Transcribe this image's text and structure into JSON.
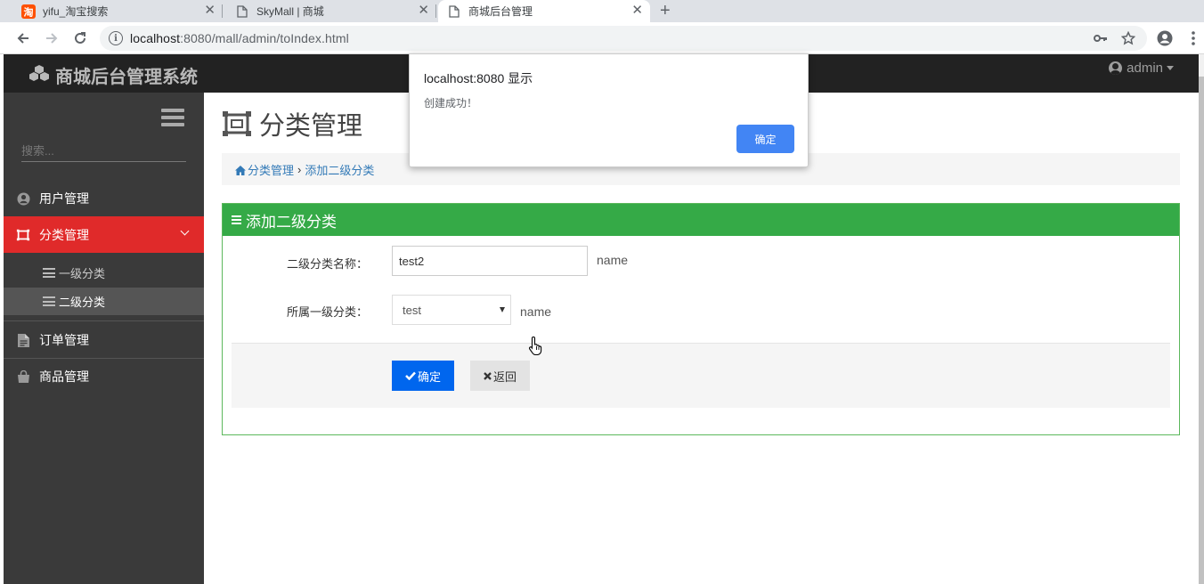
{
  "browser": {
    "tabs": [
      {
        "title": "yifu_淘宝搜索",
        "favicon": "taobao-icon"
      },
      {
        "title": "SkyMall | 商城",
        "favicon": "document-icon"
      },
      {
        "title": "商城后台管理",
        "favicon": "document-icon",
        "active": true
      }
    ],
    "new_tab": "+",
    "url_host": "localhost",
    "url_path": ":8080/mall/admin/toIndex.html"
  },
  "header": {
    "brand": "商城后台管理系统",
    "user": "admin"
  },
  "sidebar": {
    "search_placeholder": "搜索...",
    "items": [
      {
        "label": "用户管理",
        "icon": "user-circle-icon"
      },
      {
        "label": "分类管理",
        "icon": "crop-icon",
        "active": true
      },
      {
        "label": "订单管理",
        "icon": "file-text-icon"
      },
      {
        "label": "商品管理",
        "icon": "shopping-bag-icon"
      }
    ],
    "subitems": [
      {
        "label": "一级分类"
      },
      {
        "label": "二级分类",
        "current": true
      }
    ]
  },
  "main": {
    "title": "分类管理",
    "breadcrumb": {
      "root": "分类管理",
      "separator": "›",
      "current": "添加二级分类"
    },
    "panel": {
      "title": "添加二级分类",
      "name_label": "二级分类名称：",
      "name_value": "test2",
      "name_hint": "name",
      "parent_label": "所属一级分类：",
      "parent_value": "test",
      "parent_hint": "name",
      "submit_label": "确定",
      "back_label": "返回"
    }
  },
  "dialog": {
    "title": "localhost:8080 显示",
    "message": "创建成功！",
    "ok_label": "确定"
  },
  "colors": {
    "active_sidebar": "#e02a2a",
    "panel_header": "#35aa47",
    "primary_button": "#0066ee",
    "dialog_button": "#4285f4"
  }
}
